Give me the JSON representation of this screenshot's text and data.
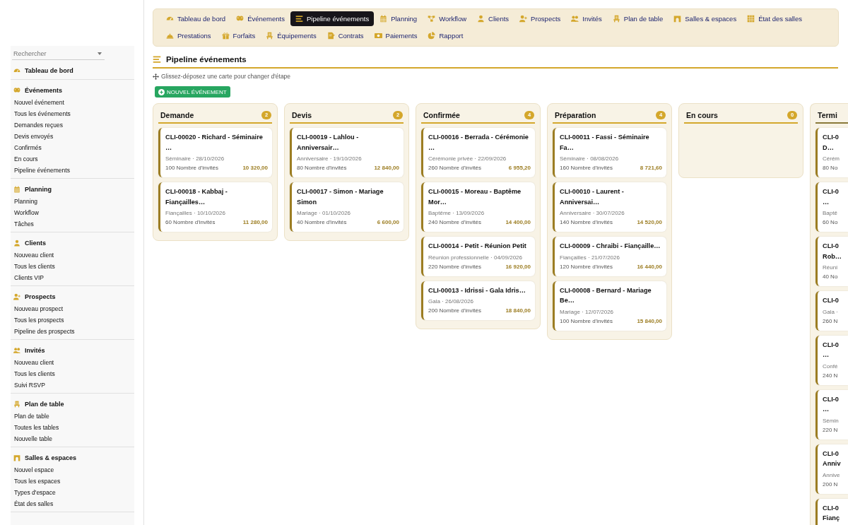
{
  "sidebar": {
    "search": {
      "placeholder": "Rechercher"
    },
    "groups": [
      {
        "title": "Tableau de bord"
      },
      {
        "title": "Événements",
        "items": [
          "Nouvel événement",
          "Tous les événements",
          "Demandes reçues",
          "Devis envoyés",
          "Confirmés",
          "En cours",
          "Pipeline événements"
        ]
      },
      {
        "title": "Planning",
        "items": [
          "Planning",
          "Workflow",
          "Tâches"
        ]
      },
      {
        "title": "Clients",
        "items": [
          "Nouveau client",
          "Tous les clients",
          "Clients VIP"
        ]
      },
      {
        "title": "Prospects",
        "items": [
          "Nouveau prospect",
          "Tous les prospects",
          "Pipeline des prospects"
        ]
      },
      {
        "title": "Invités",
        "items": [
          "Nouveau client",
          "Tous les clients",
          "Suivi RSVP"
        ]
      },
      {
        "title": "Plan de table",
        "items": [
          "Plan de table",
          "Toutes les tables",
          "Nouvelle table"
        ]
      },
      {
        "title": "Salles & espaces",
        "items": [
          "Nouvel espace",
          "Tous les espaces",
          "Types d'espace",
          "État des salles"
        ]
      }
    ]
  },
  "nav": {
    "tabs": [
      {
        "label": "Tableau de bord",
        "selected": false
      },
      {
        "label": "Événements",
        "selected": false
      },
      {
        "label": "Pipeline événements",
        "selected": true
      },
      {
        "label": "Planning",
        "selected": false
      },
      {
        "label": "Workflow",
        "selected": false
      },
      {
        "label": "Clients",
        "selected": false
      },
      {
        "label": "Prospects",
        "selected": false
      },
      {
        "label": "Invités",
        "selected": false
      },
      {
        "label": "Plan de table",
        "selected": false
      },
      {
        "label": "Salles & espaces",
        "selected": false
      },
      {
        "label": "État des salles",
        "selected": false
      },
      {
        "label": "Prestations",
        "selected": false
      },
      {
        "label": "Forfaits",
        "selected": false
      },
      {
        "label": "Équipements",
        "selected": false
      },
      {
        "label": "Contrats",
        "selected": false
      },
      {
        "label": "Paiements",
        "selected": false
      },
      {
        "label": "Rapport",
        "selected": false
      }
    ]
  },
  "page": {
    "title": "Pipeline événements",
    "hint": "Glissez-déposez une carte pour changer d'étape",
    "new_button": "NOUVEL ÉVÉNEMENT"
  },
  "columns": [
    {
      "title": "Demande",
      "count": "2",
      "cut": false,
      "cards": [
        {
          "title": "CLI-00020 - Richard - Séminaire …",
          "meta": "Séminaire · 28/10/2026",
          "guests": "100 Nombre d'invités",
          "amount": "10 320,00"
        },
        {
          "title": "CLI-00018 - Kabbaj - Fiançailles…",
          "meta": "Fiançailles · 10/10/2026",
          "guests": "60 Nombre d'invités",
          "amount": "11 280,00"
        }
      ]
    },
    {
      "title": "Devis",
      "count": "2",
      "cut": false,
      "cards": [
        {
          "title": "CLI-00019 - Lahlou - Anniversair…",
          "meta": "Anniversaire · 19/10/2026",
          "guests": "80 Nombre d'invités",
          "amount": "12 840,00"
        },
        {
          "title": "CLI-00017 - Simon - Mariage Simon",
          "meta": "Mariage · 01/10/2026",
          "guests": "40 Nombre d'invités",
          "amount": "6 600,00"
        }
      ]
    },
    {
      "title": "Confirmée",
      "count": "4",
      "cut": false,
      "cards": [
        {
          "title": "CLI-00016 - Berrada - Cérémonie …",
          "meta": "Cérémonie privée · 22/09/2026",
          "guests": "260 Nombre d'invités",
          "amount": "6 955,20"
        },
        {
          "title": "CLI-00015 - Moreau - Baptême Mor…",
          "meta": "Baptême · 13/09/2026",
          "guests": "240 Nombre d'invités",
          "amount": "14 400,00"
        },
        {
          "title": "CLI-00014 - Petit - Réunion Petit",
          "meta": "Réunion professionnelle · 04/09/2026",
          "guests": "220 Nombre d'invités",
          "amount": "16 920,00"
        },
        {
          "title": "CLI-00013 - Idrissi - Gala Idris…",
          "meta": "Gala · 26/08/2026",
          "guests": "200 Nombre d'invités",
          "amount": "18 840,00"
        }
      ]
    },
    {
      "title": "Préparation",
      "count": "4",
      "cut": false,
      "cards": [
        {
          "title": "CLI-00011 - Fassi - Séminaire Fa…",
          "meta": "Séminaire · 08/08/2026",
          "guests": "160 Nombre d'invités",
          "amount": "8 721,60"
        },
        {
          "title": "CLI-00010 - Laurent - Anniversai…",
          "meta": "Anniversaire · 30/07/2026",
          "guests": "140 Nombre d'invités",
          "amount": "14 520,00"
        },
        {
          "title": "CLI-00009 - Chraibi - Fiançaille…",
          "meta": "Fiançailles · 21/07/2026",
          "guests": "120 Nombre d'invités",
          "amount": "16 440,00"
        },
        {
          "title": "CLI-00008 - Bernard - Mariage Be…",
          "meta": "Mariage · 12/07/2026",
          "guests": "100 Nombre d'invités",
          "amount": "15 840,00"
        }
      ]
    },
    {
      "title": "En cours",
      "count": "0",
      "cut": false
    },
    {
      "title": "Termi",
      "cut": true,
      "cards": [
        {
          "title": "CLI-0 D…",
          "meta": "Cérém",
          "guests": "80 No"
        },
        {
          "title": "CLI-0 …",
          "meta": "Baptê",
          "guests": "60 No"
        },
        {
          "title": "CLI-0 Rob…",
          "meta": "Réuni",
          "guests": "40 No"
        },
        {
          "title": "CLI-0",
          "meta": "Gala ·",
          "guests": "260 N"
        },
        {
          "title": "CLI-0 …",
          "meta": "Confé",
          "guests": "240 N"
        },
        {
          "title": "CLI-0 …",
          "meta": "Sémin",
          "guests": "220 N"
        },
        {
          "title": "CLI-0 Anniv",
          "meta": "Annive",
          "guests": "200 N"
        },
        {
          "title": "CLI-0 Fianç"
        }
      ]
    }
  ]
}
